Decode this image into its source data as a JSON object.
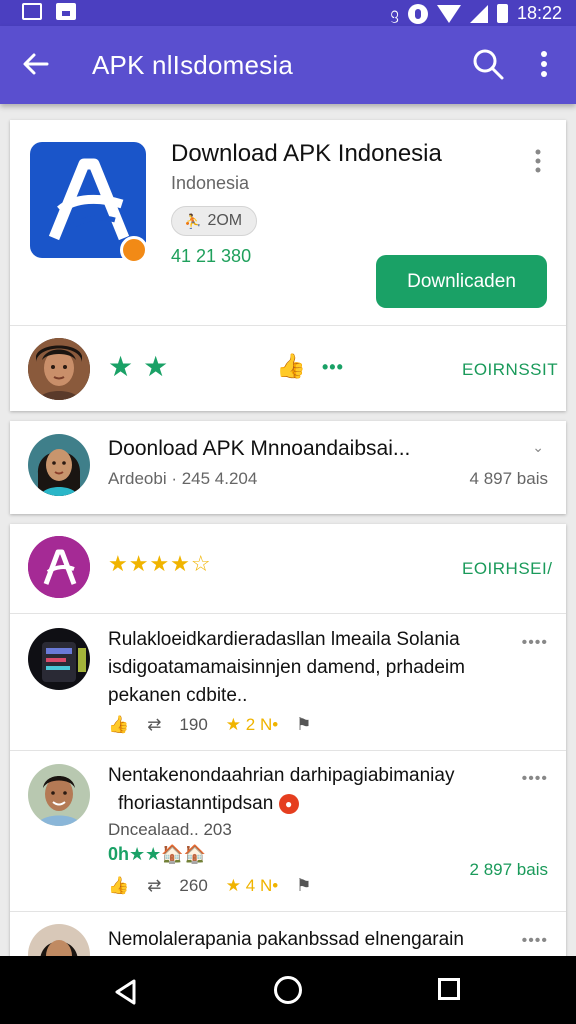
{
  "status_bar": {
    "time": "18:22",
    "vibrate_icon": "ᦋ"
  },
  "app_bar": {
    "title": "APK nlIsdomesia",
    "back_icon": "back-arrow-icon",
    "search_icon": "search-icon",
    "more_icon": "more-vert-icon"
  },
  "app_card": {
    "title": "Download APK Indonesia",
    "developer": "Indonesia",
    "size_chip": "2OM",
    "code": "41 21 380",
    "download_label": "Downlicaden",
    "more": "⋮",
    "stars": "★★",
    "thumb": "👍",
    "dots": "•••",
    "link_label": "EOIRNSSIT"
  },
  "related_card": {
    "title": "Doonload APK Mnnoandaibsai...",
    "subtitle": "Ardeobi · 245 4.204",
    "meta": "4 897 bais",
    "chevron": "⌄"
  },
  "reviews_card": {
    "header": {
      "stars": "★★★★☆",
      "link_label": "EOIRHSEI/"
    },
    "reviews": [
      {
        "text": "Rulakloeidkardieradasllan lmeaila Solania isdigoatamamaisinnjen damend, prhadeim pekanen cdbite..",
        "more": "••••",
        "like": "👍",
        "share": "⇄",
        "count": "190",
        "star_count": "★ 2 N•",
        "flag": "⚑"
      },
      {
        "text": "Nentakenondaahrian darhipagiabimaniay",
        "text2": "fhoriastanntipdsan",
        "sub": "Dncealaad.. 203",
        "green_line": "0h★★🏠🏠",
        "meta": "2 897 bais",
        "more": "••••",
        "like": "👍",
        "share": "⇄",
        "count": "260",
        "star_count": "★ 4 N•",
        "flag": "⚑"
      },
      {
        "text": "Nemolalerapania pakanbssad elnengarain",
        "more": "••••"
      }
    ]
  }
}
